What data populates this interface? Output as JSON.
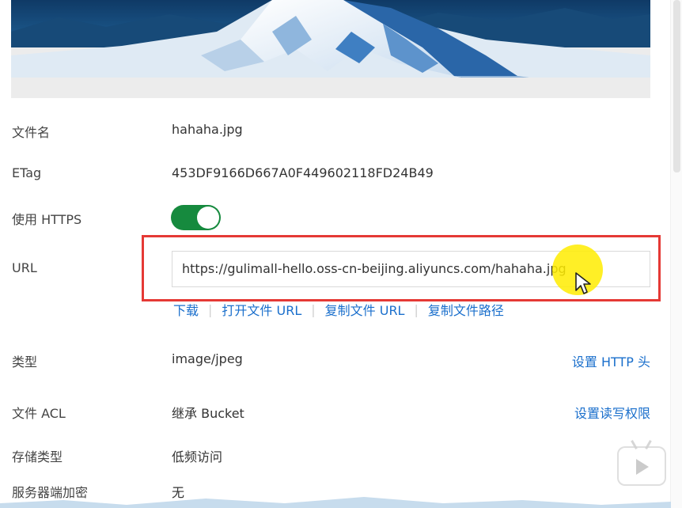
{
  "preview": {
    "alt": "snow mountain preview"
  },
  "rows": {
    "filename": {
      "label": "文件名",
      "value": "hahaha.jpg"
    },
    "etag": {
      "label": "ETag",
      "value": "453DF9166D667A0F449602118FD24B49"
    },
    "https": {
      "label": "使用 HTTPS",
      "enabled": true
    },
    "url": {
      "label": "URL",
      "value": "https://gulimall-hello.oss-cn-beijing.aliyuncs.com/hahaha.jpg"
    },
    "type": {
      "label": "类型",
      "value": "image/jpeg",
      "action": "设置 HTTP 头"
    },
    "acl": {
      "label": "文件 ACL",
      "value": "继承 Bucket",
      "action": "设置读写权限"
    },
    "storage": {
      "label": "存储类型",
      "value": "低频访问"
    },
    "encryption": {
      "label": "服务器端加密",
      "value": "无"
    }
  },
  "actions": {
    "download": "下载",
    "open_url": "打开文件 URL",
    "copy_url": "复制文件 URL",
    "copy_path": "复制文件路径"
  },
  "colors": {
    "link": "#1a6fcc",
    "toggle_on": "#168a3e",
    "highlight": "#e53935"
  }
}
